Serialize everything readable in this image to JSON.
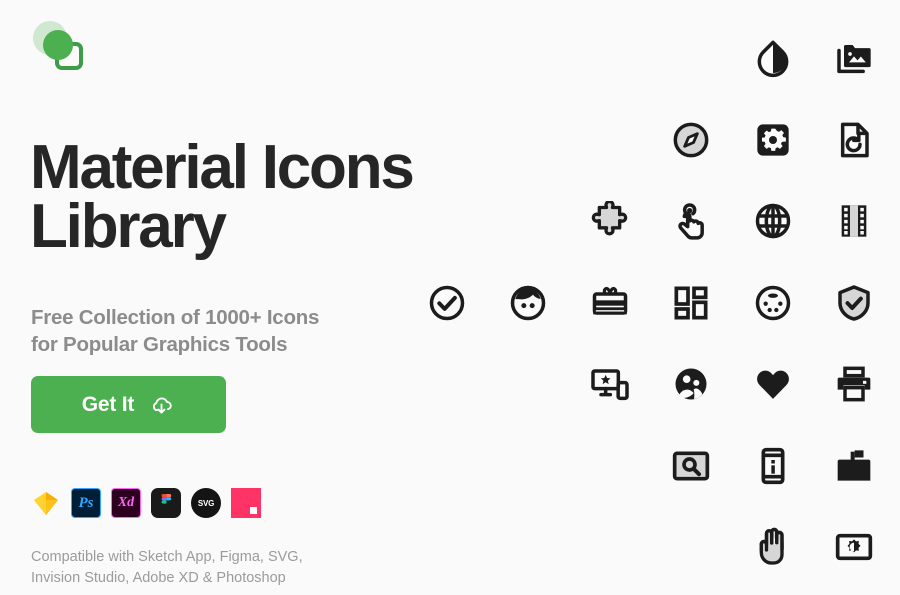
{
  "brand": {
    "logo_name": "material-icons-library-logo",
    "green": "#4caf50",
    "dark_green": "#3f9d4a",
    "pale_green": "#cfe8cf"
  },
  "hero": {
    "title_line1": "Material Icons",
    "title_line2": "Library",
    "title_color": "#262626",
    "subtitle_line1": "Free Collection of 1000+ Icons",
    "subtitle_line2": "for Popular Graphics Tools",
    "subtitle_color": "#8c8c8c"
  },
  "cta": {
    "label": "Get It",
    "icon": "cloud-download-icon",
    "background": "#4caf50",
    "text_color": "#ffffff"
  },
  "badges": [
    {
      "name": "sketch-badge",
      "label": "Sketch",
      "color": "#fdb300"
    },
    {
      "name": "photoshop-badge",
      "label": "Ps",
      "color": "#31a8ff"
    },
    {
      "name": "adobe-xd-badge",
      "label": "Xd",
      "color": "#ff61f6"
    },
    {
      "name": "figma-badge",
      "label": "Figma",
      "color": "#1a1a1a"
    },
    {
      "name": "svg-badge",
      "label": "SVG",
      "color": "#141414"
    },
    {
      "name": "invision-studio-badge",
      "label": "Invision Studio",
      "color": "#ff3366"
    }
  ],
  "compatibility": {
    "line1": "Compatible with Sketch App, Figma, SVG,",
    "line2": "Invision Studio, Adobe XD & Photoshop",
    "color": "#9b9b9b"
  },
  "icon_grid": {
    "icon_color": "#1c1c1c",
    "fill_gray": "#d6d6d6",
    "rows": [
      {
        "icons": [
          "opacity-icon",
          "photo-library-icon"
        ]
      },
      {
        "icons": [
          "explore-compass-icon",
          "settings-applications-icon",
          "restore-page-icon"
        ]
      },
      {
        "icons": [
          "extension-puzzle-icon",
          "touch-app-icon",
          "language-globe-icon",
          "theaters-film-icon"
        ]
      },
      {
        "icons": [
          "check-circle-icon",
          "face-icon",
          "card-giftcard-icon",
          "dashboard-icon",
          "settings-input-svideo-icon",
          "verified-user-icon"
        ]
      },
      {
        "icons": [
          "important-devices-icon",
          "people-group-icon",
          "favorite-heart-icon",
          "print-icon"
        ]
      },
      {
        "icons": [
          "screen-search-desktop-icon",
          "phonelink-info-icon",
          "markunread-mailbox-icon"
        ]
      },
      {
        "icons": [
          "pan-tool-icon",
          "settings-brightness-icon"
        ]
      }
    ]
  }
}
